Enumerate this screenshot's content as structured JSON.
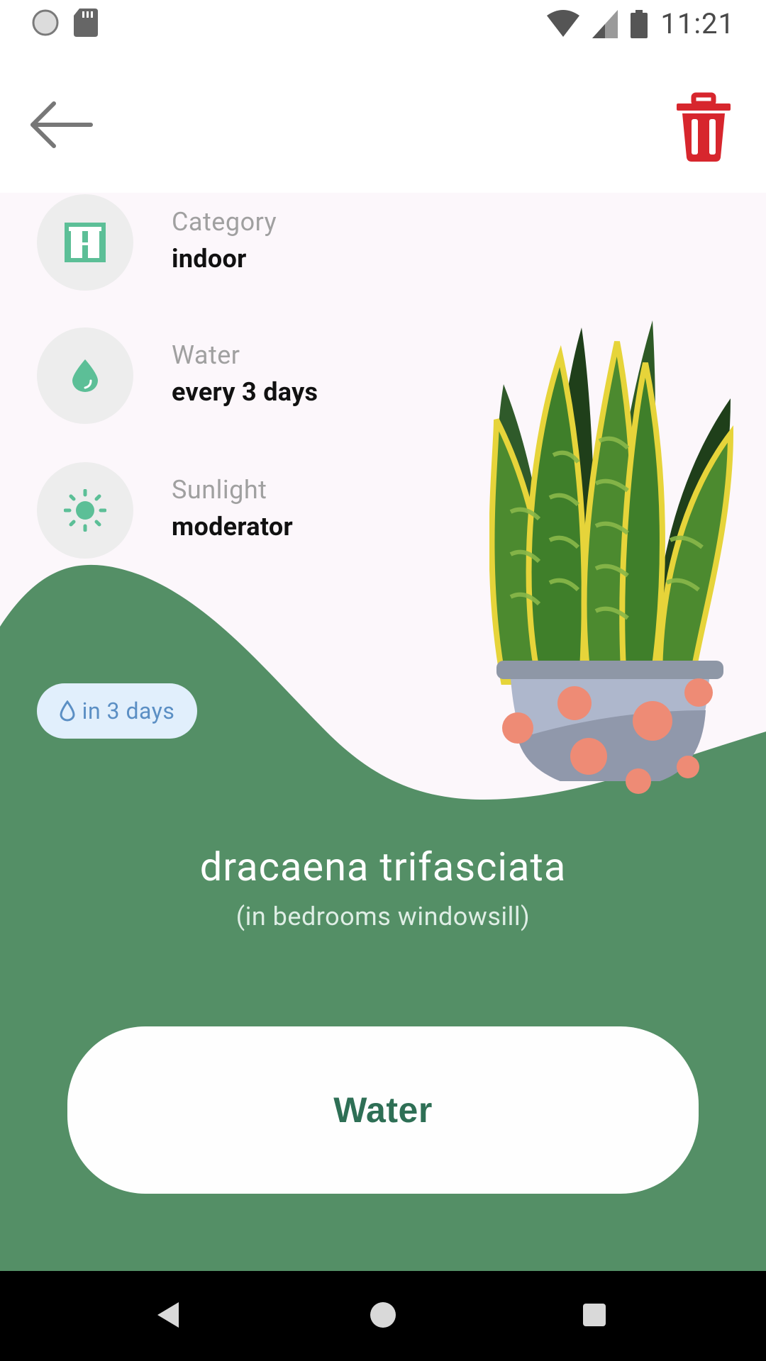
{
  "status_bar": {
    "time": "11:21"
  },
  "colors": {
    "green": "#548f66",
    "accent_green": "#5cbf97",
    "delete_red": "#d7262d",
    "badge_bg": "#e1effc",
    "badge_text": "#5b8fc4"
  },
  "info": [
    {
      "icon": "window-icon",
      "label": "Category",
      "value": "indoor"
    },
    {
      "icon": "droplet-icon",
      "label": "Water",
      "value": "every 3 days"
    },
    {
      "icon": "sun-icon",
      "label": "Sunlight",
      "value": "moderator"
    }
  ],
  "badge": {
    "icon": "droplet-outline-icon",
    "text": "in 3 days"
  },
  "plant": {
    "name": "dracaena trifasciata",
    "location": "(in bedrooms windowsill)"
  },
  "actions": {
    "water_label": "Water"
  }
}
